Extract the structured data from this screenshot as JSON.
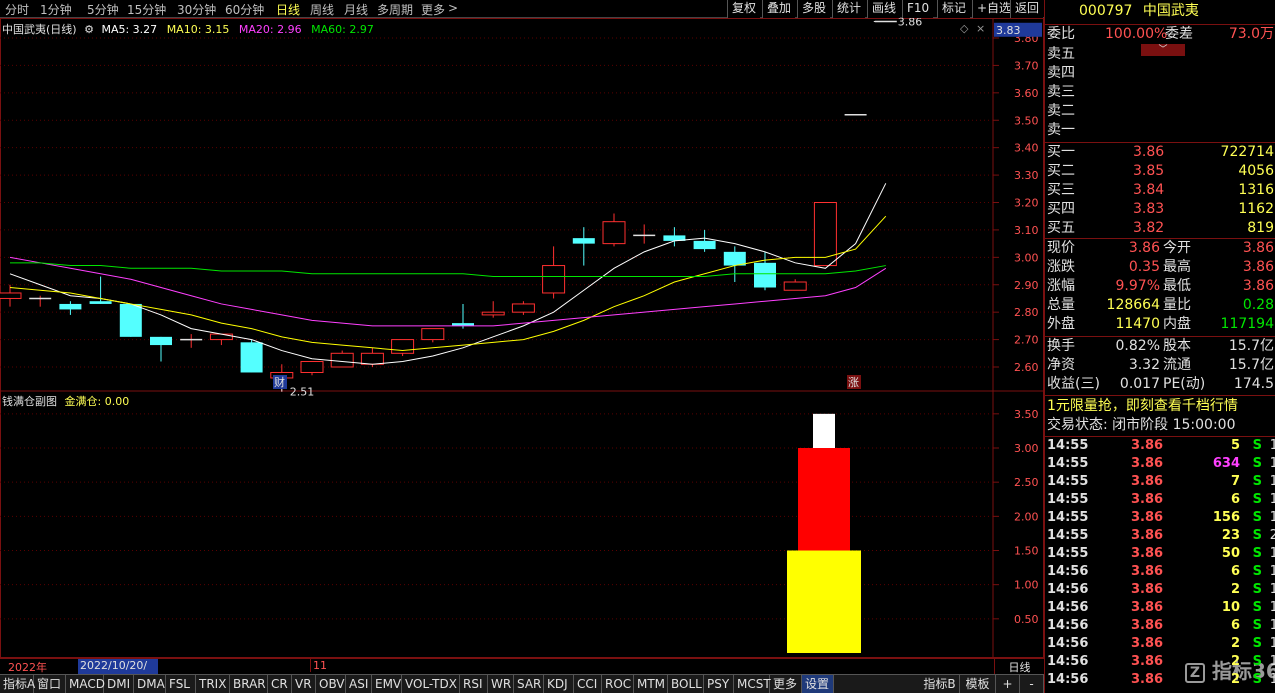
{
  "toolbar": {
    "periods": [
      "分时",
      "1分钟",
      "5分钟",
      "15分钟",
      "30分钟",
      "60分钟",
      "日线",
      "周线",
      "月线",
      "多周期",
      "更多"
    ],
    "active_period": "日线",
    "more_arrow": ">",
    "buttons": [
      "复权",
      "叠加",
      "多股",
      "统计",
      "画线",
      "F10",
      "标记",
      "+自选",
      "返回"
    ]
  },
  "main_chart": {
    "title": "中国武夷(日线)",
    "ma5": "MA5: 3.27",
    "ma10": "MA10: 3.15",
    "ma20": "MA20: 2.96",
    "ma60": "MA60: 2.97",
    "high_label": "3.86",
    "low_label": "2.51",
    "current_price_tag": "3.83",
    "price_ticks": [
      "3.80",
      "3.70",
      "3.60",
      "3.50",
      "3.40",
      "3.30",
      "3.20",
      "3.10",
      "3.00",
      "2.90",
      "2.80",
      "2.70",
      "2.60"
    ],
    "marker_cai": "财",
    "marker_zhang": "涨",
    "colors": {
      "ma5": "#ffffff",
      "ma10": "#ffff00",
      "ma20": "#ff40ff",
      "ma60": "#00e600",
      "up": "#ff3030",
      "down": "#54ffff"
    }
  },
  "sub_chart": {
    "title": "钱满仓副图",
    "value_label": "金满仓: 0.00",
    "ticks": [
      "3.50",
      "3.00",
      "2.50",
      "2.00",
      "1.50",
      "1.00",
      "0.50"
    ]
  },
  "chart_data": [
    {
      "type": "candlestick",
      "title": "中国武夷(日线)",
      "ylim": [
        2.5,
        3.85
      ],
      "candles": [
        {
          "o": 2.85,
          "h": 2.9,
          "l": 2.82,
          "c": 2.87
        },
        {
          "o": 2.85,
          "h": 2.86,
          "l": 2.82,
          "c": 2.85
        },
        {
          "o": 2.83,
          "h": 2.84,
          "l": 2.79,
          "c": 2.81
        },
        {
          "o": 2.84,
          "h": 2.93,
          "l": 2.83,
          "c": 2.83
        },
        {
          "o": 2.83,
          "h": 2.83,
          "l": 2.71,
          "c": 2.71
        },
        {
          "o": 2.71,
          "h": 2.71,
          "l": 2.62,
          "c": 2.68
        },
        {
          "o": 2.7,
          "h": 2.72,
          "l": 2.67,
          "c": 2.7
        },
        {
          "o": 2.7,
          "h": 2.72,
          "l": 2.68,
          "c": 2.72
        },
        {
          "o": 2.69,
          "h": 2.7,
          "l": 2.58,
          "c": 2.58
        },
        {
          "o": 2.56,
          "h": 2.61,
          "l": 2.51,
          "c": 2.58
        },
        {
          "o": 2.58,
          "h": 2.62,
          "l": 2.57,
          "c": 2.62
        },
        {
          "o": 2.6,
          "h": 2.66,
          "l": 2.6,
          "c": 2.65
        },
        {
          "o": 2.61,
          "h": 2.67,
          "l": 2.6,
          "c": 2.65
        },
        {
          "o": 2.65,
          "h": 2.7,
          "l": 2.64,
          "c": 2.7
        },
        {
          "o": 2.7,
          "h": 2.74,
          "l": 2.69,
          "c": 2.74
        },
        {
          "o": 2.76,
          "h": 2.83,
          "l": 2.74,
          "c": 2.75
        },
        {
          "o": 2.79,
          "h": 2.84,
          "l": 2.78,
          "c": 2.8
        },
        {
          "o": 2.8,
          "h": 2.84,
          "l": 2.79,
          "c": 2.83
        },
        {
          "o": 2.87,
          "h": 3.04,
          "l": 2.85,
          "c": 2.97
        },
        {
          "o": 3.07,
          "h": 3.11,
          "l": 2.97,
          "c": 3.05
        },
        {
          "o": 3.05,
          "h": 3.16,
          "l": 3.04,
          "c": 3.13
        },
        {
          "o": 3.08,
          "h": 3.12,
          "l": 3.05,
          "c": 3.08
        },
        {
          "o": 3.08,
          "h": 3.11,
          "l": 3.04,
          "c": 3.06
        },
        {
          "o": 3.06,
          "h": 3.1,
          "l": 3.02,
          "c": 3.03
        },
        {
          "o": 3.02,
          "h": 3.04,
          "l": 2.91,
          "c": 2.97
        },
        {
          "o": 2.98,
          "h": 3.02,
          "l": 2.88,
          "c": 2.89
        },
        {
          "o": 2.88,
          "h": 2.92,
          "l": 2.88,
          "c": 2.91
        },
        {
          "o": 2.97,
          "h": 3.2,
          "l": 2.97,
          "c": 3.2
        },
        {
          "o": 3.52,
          "h": 3.52,
          "l": 3.52,
          "c": 3.52
        },
        {
          "o": 3.86,
          "h": 3.86,
          "l": 3.86,
          "c": 3.86
        }
      ],
      "series": [
        {
          "name": "MA5",
          "values": [
            2.94,
            2.9,
            2.86,
            2.85,
            2.83,
            2.79,
            2.74,
            2.72,
            2.7,
            2.66,
            2.63,
            2.62,
            2.61,
            2.62,
            2.64,
            2.67,
            2.71,
            2.75,
            2.8,
            2.88,
            2.96,
            3.02,
            3.06,
            3.07,
            3.05,
            3.02,
            2.98,
            2.96,
            3.05,
            3.27
          ]
        },
        {
          "name": "MA10",
          "values": [
            2.89,
            2.88,
            2.87,
            2.85,
            2.83,
            2.81,
            2.79,
            2.76,
            2.74,
            2.71,
            2.69,
            2.68,
            2.67,
            2.66,
            2.67,
            2.68,
            2.69,
            2.7,
            2.73,
            2.77,
            2.82,
            2.86,
            2.91,
            2.94,
            2.97,
            2.99,
            3.0,
            3.0,
            3.03,
            3.15
          ]
        },
        {
          "name": "MA20",
          "values": [
            3.0,
            2.98,
            2.96,
            2.94,
            2.92,
            2.89,
            2.86,
            2.83,
            2.81,
            2.79,
            2.77,
            2.76,
            2.75,
            2.75,
            2.75,
            2.75,
            2.75,
            2.76,
            2.77,
            2.78,
            2.79,
            2.8,
            2.81,
            2.82,
            2.83,
            2.84,
            2.85,
            2.86,
            2.89,
            2.96
          ]
        },
        {
          "name": "MA60",
          "values": [
            2.98,
            2.98,
            2.97,
            2.97,
            2.96,
            2.96,
            2.96,
            2.95,
            2.95,
            2.95,
            2.94,
            2.94,
            2.94,
            2.94,
            2.94,
            2.94,
            2.93,
            2.93,
            2.93,
            2.93,
            2.93,
            2.93,
            2.93,
            2.93,
            2.94,
            2.94,
            2.94,
            2.94,
            2.95,
            2.97
          ]
        }
      ]
    },
    {
      "type": "bar",
      "title": "钱满仓副图",
      "ylim": [
        0,
        3.6
      ],
      "stack": [
        {
          "color": "#ffff00",
          "from": 0,
          "to": 1.5
        },
        {
          "color": "#ff0000",
          "from": 1.5,
          "to": 3.0
        },
        {
          "color": "#ffffff",
          "from": 3.0,
          "to": 3.5
        }
      ]
    }
  ],
  "date_bar": {
    "year": "2022年",
    "date": "2022/10/20/四",
    "month": "11",
    "period_label": "日线"
  },
  "bottom_tabs": [
    "指标A",
    "窗口",
    "MACD",
    "DMI",
    "DMA",
    "FSL",
    "TRIX",
    "BRAR",
    "CR",
    "VR",
    "OBV",
    "ASI",
    "EMV",
    "VOL-TDX",
    "RSI",
    "WR",
    "SAR",
    "KDJ",
    "CCI",
    "ROC",
    "MTM",
    "BOLL",
    "PSY",
    "MCST",
    "更多",
    "设置"
  ],
  "bottom_right": [
    "指标B",
    "模板",
    "+",
    "-"
  ],
  "stock": {
    "code": "000797",
    "name": "中国武夷"
  },
  "weibi": {
    "label": "委比",
    "value": "100.00%",
    "diff_label": "委差",
    "diff_value": "73.0万"
  },
  "sell_levels": [
    "卖五",
    "卖四",
    "卖三",
    "卖二",
    "卖一"
  ],
  "buy_levels": [
    {
      "label": "买一",
      "price": "3.86",
      "vol": "722714"
    },
    {
      "label": "买二",
      "price": "3.85",
      "vol": "4056"
    },
    {
      "label": "买三",
      "price": "3.84",
      "vol": "1316"
    },
    {
      "label": "买四",
      "price": "3.83",
      "vol": "1162"
    },
    {
      "label": "买五",
      "price": "3.82",
      "vol": "819"
    }
  ],
  "quote": [
    {
      "l1": "现价",
      "v1": "3.86",
      "l2": "今开",
      "v2": "3.86"
    },
    {
      "l1": "涨跌",
      "v1": "0.35",
      "l2": "最高",
      "v2": "3.86"
    },
    {
      "l1": "涨幅",
      "v1": "9.97%",
      "l2": "最低",
      "v2": "3.86"
    },
    {
      "l1": "总量",
      "v1": "128664",
      "l2": "量比",
      "v2": "0.28"
    },
    {
      "l1": "外盘",
      "v1": "11470",
      "l2": "内盘",
      "v2": "117194"
    }
  ],
  "fundamentals": [
    {
      "l1": "换手",
      "v1": "0.82%",
      "l2": "股本",
      "v2": "15.7亿"
    },
    {
      "l1": "净资",
      "v1": "3.32",
      "l2": "流通",
      "v2": "15.7亿"
    },
    {
      "l1": "收益(三)",
      "v1": "0.017",
      "l2": "PE(动)",
      "v2": "174.5"
    }
  ],
  "ad_text": "1元限量抢，即刻查看千档行情",
  "trade_status": "交易状态: 闭市阶段 15:00:00",
  "ticks": [
    {
      "t": "14:55",
      "p": "3.86",
      "v": "5",
      "s": "S",
      "n": "1"
    },
    {
      "t": "14:55",
      "p": "3.86",
      "v": "634",
      "s": "S",
      "n": "1"
    },
    {
      "t": "14:55",
      "p": "3.86",
      "v": "7",
      "s": "S",
      "n": "1"
    },
    {
      "t": "14:55",
      "p": "3.86",
      "v": "6",
      "s": "S",
      "n": "1"
    },
    {
      "t": "14:55",
      "p": "3.86",
      "v": "156",
      "s": "S",
      "n": "1"
    },
    {
      "t": "14:55",
      "p": "3.86",
      "v": "23",
      "s": "S",
      "n": "2"
    },
    {
      "t": "14:55",
      "p": "3.86",
      "v": "50",
      "s": "S",
      "n": "1"
    },
    {
      "t": "14:56",
      "p": "3.86",
      "v": "6",
      "s": "S",
      "n": "1"
    },
    {
      "t": "14:56",
      "p": "3.86",
      "v": "2",
      "s": "S",
      "n": "1"
    },
    {
      "t": "14:56",
      "p": "3.86",
      "v": "10",
      "s": "S",
      "n": "1"
    },
    {
      "t": "14:56",
      "p": "3.86",
      "v": "6",
      "s": "S",
      "n": "1"
    },
    {
      "t": "14:56",
      "p": "3.86",
      "v": "2",
      "s": "S",
      "n": "1"
    },
    {
      "t": "14:56",
      "p": "3.86",
      "v": "2",
      "s": "S",
      "n": "1"
    },
    {
      "t": "14:56",
      "p": "3.86",
      "v": "2",
      "s": "S",
      "n": "1"
    }
  ],
  "watermark": "指标365"
}
